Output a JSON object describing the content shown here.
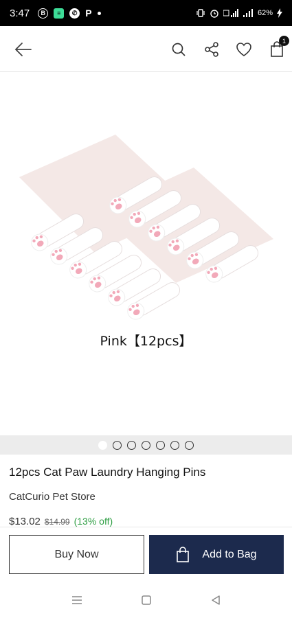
{
  "status_bar": {
    "time": "3:47",
    "p_label": "P",
    "battery": "62%"
  },
  "header": {
    "icons": [
      "back-arrow-icon",
      "search-icon",
      "share-icon",
      "heart-icon",
      "shopping-bag-icon"
    ],
    "cart_count": "1"
  },
  "gallery": {
    "caption": "Pink【12pcs】",
    "dots_total": 7,
    "active_dot": 0
  },
  "product": {
    "title": "12pcs Cat Paw Laundry Hanging Pins",
    "store": "CatCurio Pet Store",
    "price": "$13.02",
    "old_price": "$14.99",
    "discount": "(13% off)"
  },
  "actions": {
    "buy_now": "Buy Now",
    "add_to_bag": "Add to Bag"
  },
  "colors": {
    "primary_button": "#1c2a4d",
    "discount": "#2e9e43",
    "paw_pink": "#f2a9b9"
  }
}
